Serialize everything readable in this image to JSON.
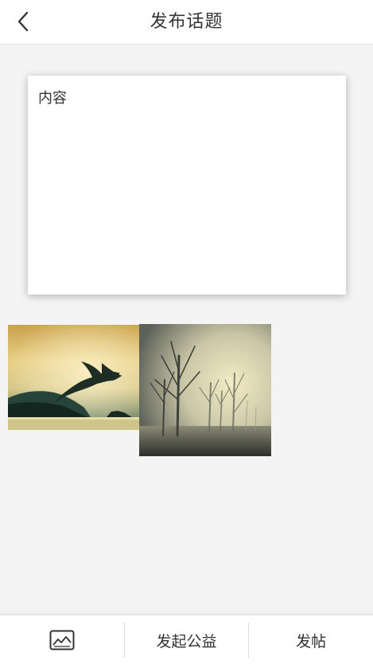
{
  "header": {
    "title": "发布话题",
    "back_icon": "chevron-left-icon"
  },
  "editor": {
    "placeholder": "内容"
  },
  "photos": [
    {
      "description_icon": "seagull-photo"
    },
    {
      "description_icon": "foggy-trees-photo"
    }
  ],
  "bottom_bar": {
    "image_icon": "image-icon",
    "charity_label": "发起公益",
    "post_label": "发帖"
  }
}
